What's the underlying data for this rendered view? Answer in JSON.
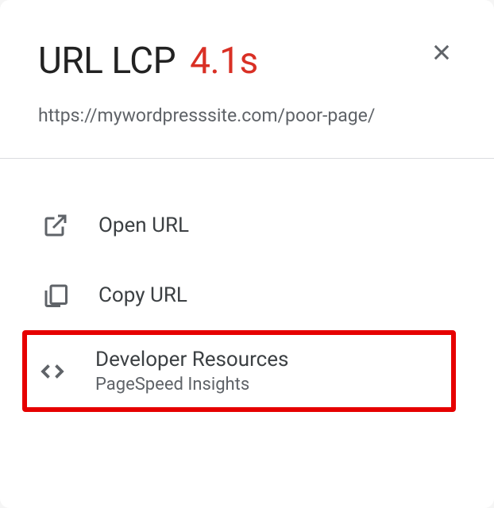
{
  "header": {
    "title": "URL LCP",
    "metric": "4.1s"
  },
  "url": "https://mywordpresssite.com/poor-page/",
  "actions": [
    {
      "label": "Open URL",
      "sublabel": ""
    },
    {
      "label": "Copy URL",
      "sublabel": ""
    },
    {
      "label": "Developer Resources",
      "sublabel": "PageSpeed Insights"
    }
  ]
}
